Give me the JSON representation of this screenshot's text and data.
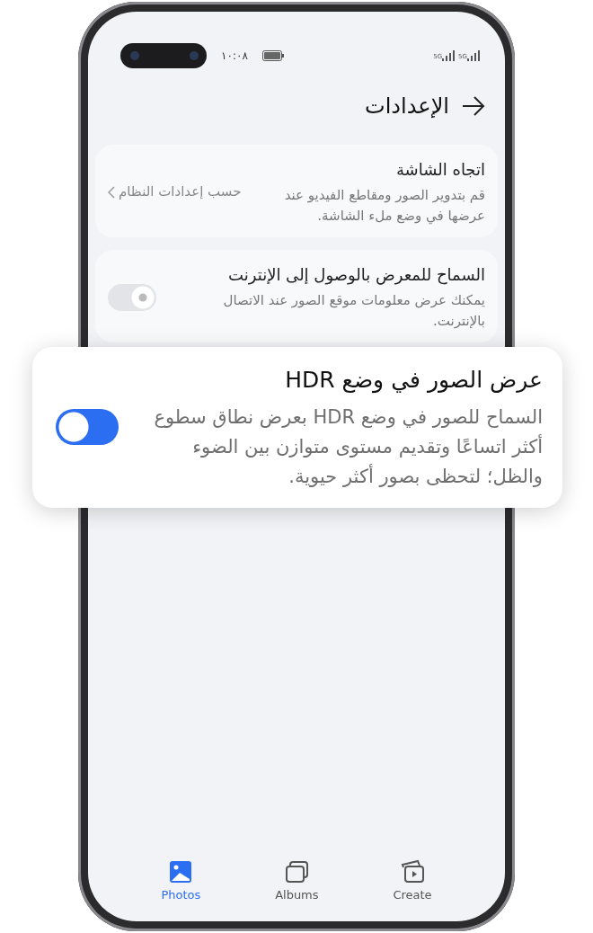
{
  "status_bar": {
    "time": "١٠:٠٨",
    "signal_labels": [
      "5G",
      "5G"
    ]
  },
  "header": {
    "title": "الإعدادات"
  },
  "settings": [
    {
      "kind": "link",
      "title": "اتجاه الشاشة",
      "description": "قم بتدوير الصور ومقاطع الفيديو عند عرضها في وضع ملء الشاشة.",
      "value": "حسب إعدادات النظام"
    },
    {
      "kind": "switch",
      "title": "السماح للمعرض بالوصول إلى الإنترنت",
      "description": "يمكنك عرض معلومات موقع الصور عند الاتصال بالإنترنت.",
      "on": false
    }
  ],
  "callout": {
    "title": "عرض الصور في وضع HDR",
    "description": "السماح للصور في وضع HDR بعرض نطاق سطوع أكثر اتساعًا وتقديم مستوى متوازن بين الضوء والظل؛ لتحظى بصور أكثر حيوية.",
    "on": true
  },
  "bottom_nav": [
    {
      "label": "Create",
      "kind": "create",
      "selected": false
    },
    {
      "label": "Albums",
      "kind": "albums",
      "selected": false
    },
    {
      "label": "Photos",
      "kind": "photos",
      "selected": true
    }
  ]
}
